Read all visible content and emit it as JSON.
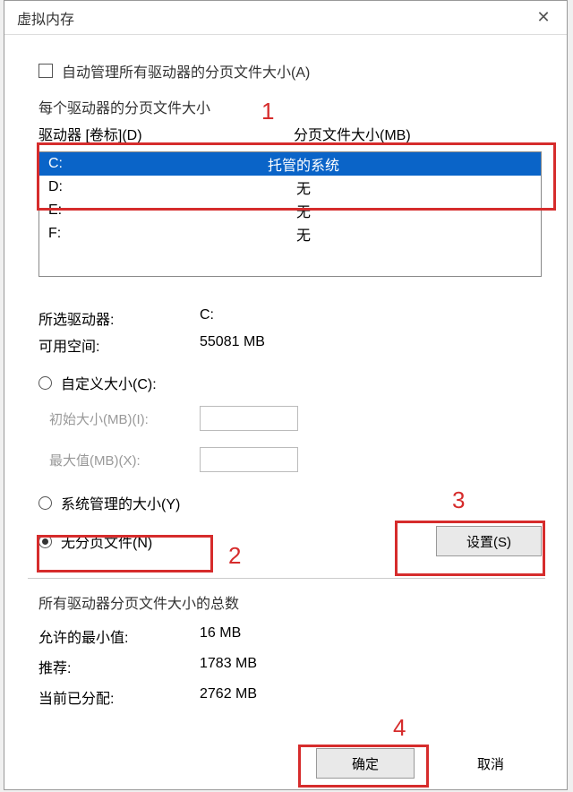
{
  "window": {
    "title": "虚拟内存"
  },
  "auto_manage_label": "自动管理所有驱动器的分页文件大小(A)",
  "each_drive_label": "每个驱动器的分页文件大小",
  "list_headers": {
    "drive": "驱动器 [卷标](D)",
    "size": "分页文件大小(MB)"
  },
  "drives": [
    {
      "letter": "C:",
      "value": "托管的系统",
      "selected": true
    },
    {
      "letter": "D:",
      "value": "无",
      "selected": false
    },
    {
      "letter": "E:",
      "value": "无",
      "selected": false
    },
    {
      "letter": "F:",
      "value": "无",
      "selected": false
    }
  ],
  "selected_drive": {
    "label": "所选驱动器:",
    "value": "C:"
  },
  "free_space": {
    "label": "可用空间:",
    "value": "55081 MB"
  },
  "radio_custom": "自定义大小(C):",
  "initial_size_label": "初始大小(MB)(I):",
  "max_size_label": "最大值(MB)(X):",
  "radio_system": "系统管理的大小(Y)",
  "radio_none": "无分页文件(N)",
  "set_button": "设置(S)",
  "totals_header": "所有驱动器分页文件大小的总数",
  "min_allowed": {
    "label": "允许的最小值:",
    "value": "16 MB"
  },
  "recommended": {
    "label": "推荐:",
    "value": "1783 MB"
  },
  "current": {
    "label": "当前已分配:",
    "value": "2762 MB"
  },
  "ok_button": "确定",
  "cancel_button": "取消",
  "annotations": {
    "a1": "1",
    "a2": "2",
    "a3": "3",
    "a4": "4"
  }
}
